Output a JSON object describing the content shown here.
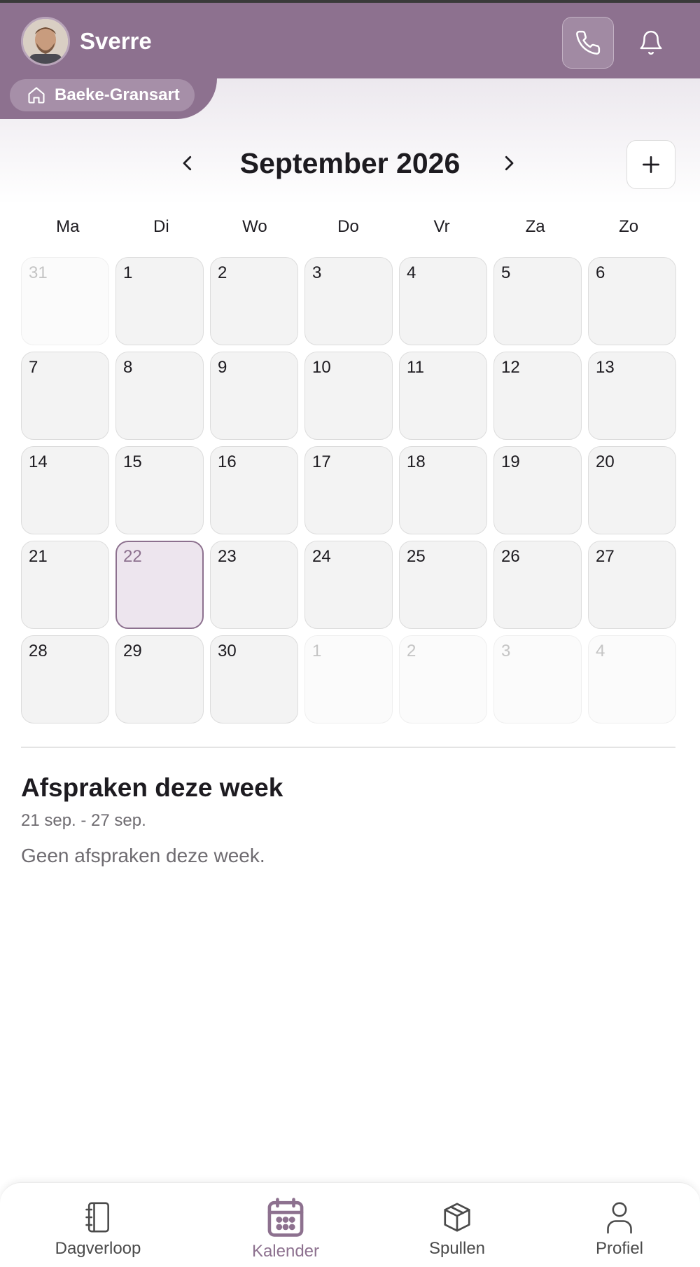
{
  "header": {
    "username": "Sverre",
    "location": "Baeke-Gransart",
    "colors": {
      "brand": "#8d718f",
      "chip": "#a68fa8",
      "today_fill": "#ede5ee"
    },
    "icons": {
      "phone": "phone-icon",
      "bell": "bell-icon",
      "home": "home-icon"
    }
  },
  "calendar": {
    "month_label": "September 2026",
    "weekdays": [
      "Ma",
      "Di",
      "Wo",
      "Do",
      "Vr",
      "Za",
      "Zo"
    ],
    "days": [
      {
        "label": "31",
        "in_month": false
      },
      {
        "label": "1",
        "in_month": true
      },
      {
        "label": "2",
        "in_month": true
      },
      {
        "label": "3",
        "in_month": true
      },
      {
        "label": "4",
        "in_month": true
      },
      {
        "label": "5",
        "in_month": true
      },
      {
        "label": "6",
        "in_month": true
      },
      {
        "label": "7",
        "in_month": true
      },
      {
        "label": "8",
        "in_month": true
      },
      {
        "label": "9",
        "in_month": true
      },
      {
        "label": "10",
        "in_month": true
      },
      {
        "label": "11",
        "in_month": true
      },
      {
        "label": "12",
        "in_month": true
      },
      {
        "label": "13",
        "in_month": true
      },
      {
        "label": "14",
        "in_month": true
      },
      {
        "label": "15",
        "in_month": true
      },
      {
        "label": "16",
        "in_month": true
      },
      {
        "label": "17",
        "in_month": true
      },
      {
        "label": "18",
        "in_month": true
      },
      {
        "label": "19",
        "in_month": true
      },
      {
        "label": "20",
        "in_month": true
      },
      {
        "label": "21",
        "in_month": true
      },
      {
        "label": "22",
        "in_month": true,
        "today": true
      },
      {
        "label": "23",
        "in_month": true
      },
      {
        "label": "24",
        "in_month": true
      },
      {
        "label": "25",
        "in_month": true
      },
      {
        "label": "26",
        "in_month": true
      },
      {
        "label": "27",
        "in_month": true
      },
      {
        "label": "28",
        "in_month": true
      },
      {
        "label": "29",
        "in_month": true
      },
      {
        "label": "30",
        "in_month": true
      },
      {
        "label": "1",
        "in_month": false
      },
      {
        "label": "2",
        "in_month": false
      },
      {
        "label": "3",
        "in_month": false
      },
      {
        "label": "4",
        "in_month": false
      }
    ]
  },
  "week_section": {
    "title": "Afspraken deze week",
    "range": "21 sep. - 27 sep.",
    "empty_text": "Geen afspraken deze week."
  },
  "bottom_nav": {
    "items": [
      {
        "label": "Dagverloop",
        "icon": "notebook-icon",
        "active": false
      },
      {
        "label": "Kalender",
        "icon": "calendar-icon",
        "active": true
      },
      {
        "label": "Spullen",
        "icon": "box-icon",
        "active": false
      },
      {
        "label": "Profiel",
        "icon": "person-icon",
        "active": false
      }
    ]
  }
}
